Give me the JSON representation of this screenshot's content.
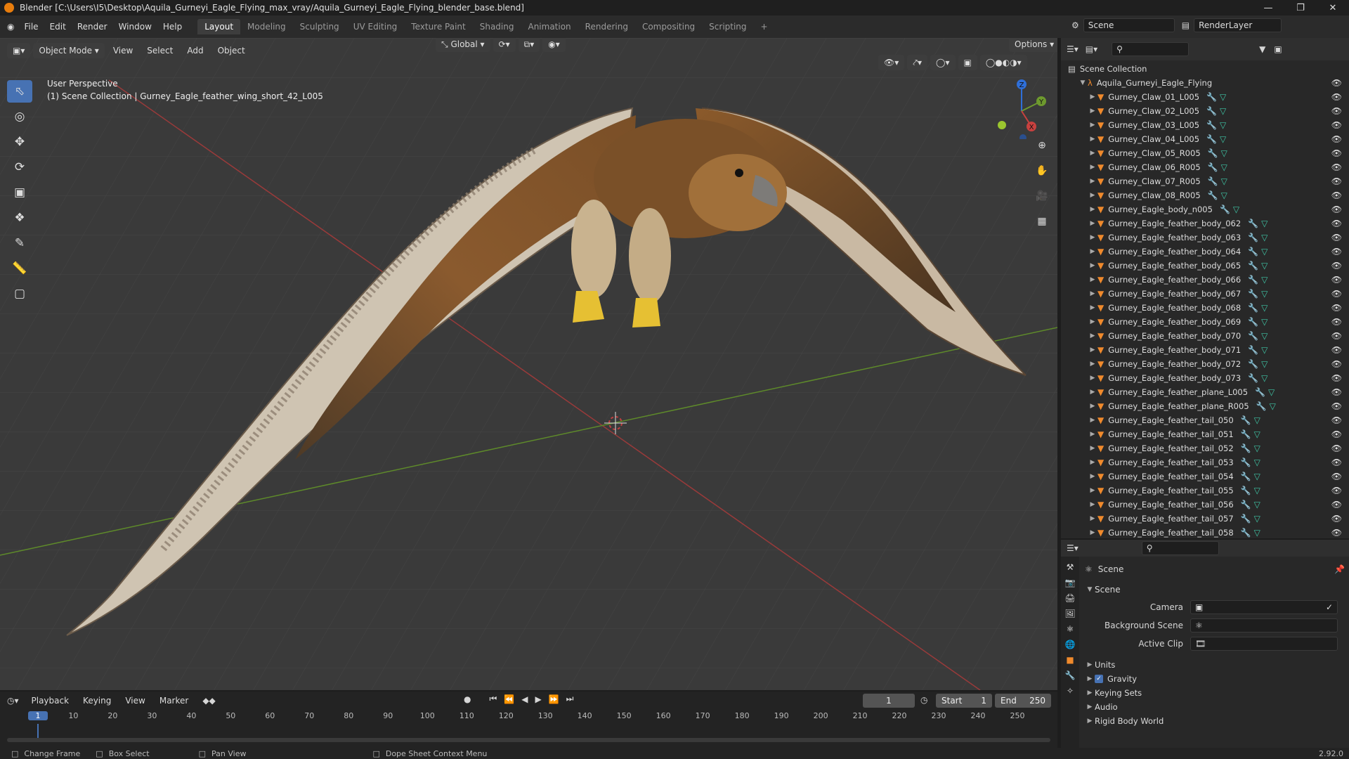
{
  "titlebar": {
    "title": "Blender [C:\\Users\\I5\\Desktop\\Aquila_Gurneyi_Eagle_Flying_max_vray/Aquila_Gurneyi_Eagle_Flying_blender_base.blend]"
  },
  "menus": [
    "File",
    "Edit",
    "Render",
    "Window",
    "Help"
  ],
  "workspaces": [
    "Layout",
    "Modeling",
    "Sculpting",
    "UV Editing",
    "Texture Paint",
    "Shading",
    "Animation",
    "Rendering",
    "Compositing",
    "Scripting"
  ],
  "top_right": {
    "scene": "Scene",
    "render_layer": "RenderLayer"
  },
  "viewport": {
    "mode": "Object Mode",
    "menu": [
      "View",
      "Select",
      "Add",
      "Object"
    ],
    "orientation": "Global",
    "options": "Options",
    "overlay_title": "User Perspective",
    "overlay_sub": "(1) Scene Collection | Gurney_Eagle_feather_wing_short_42_L005",
    "gizmo_axes": [
      "Z",
      "Y",
      "X"
    ]
  },
  "outliner": {
    "root": "Scene Collection",
    "collection": "Aquila_Gurneyi_Eagle_Flying",
    "items": [
      "Gurney_Claw_01_L005",
      "Gurney_Claw_02_L005",
      "Gurney_Claw_03_L005",
      "Gurney_Claw_04_L005",
      "Gurney_Claw_05_R005",
      "Gurney_Claw_06_R005",
      "Gurney_Claw_07_R005",
      "Gurney_Claw_08_R005",
      "Gurney_Eagle_body_n005",
      "Gurney_Eagle_feather_body_062",
      "Gurney_Eagle_feather_body_063",
      "Gurney_Eagle_feather_body_064",
      "Gurney_Eagle_feather_body_065",
      "Gurney_Eagle_feather_body_066",
      "Gurney_Eagle_feather_body_067",
      "Gurney_Eagle_feather_body_068",
      "Gurney_Eagle_feather_body_069",
      "Gurney_Eagle_feather_body_070",
      "Gurney_Eagle_feather_body_071",
      "Gurney_Eagle_feather_body_072",
      "Gurney_Eagle_feather_body_073",
      "Gurney_Eagle_feather_plane_L005",
      "Gurney_Eagle_feather_plane_R005",
      "Gurney_Eagle_feather_tail_050",
      "Gurney_Eagle_feather_tail_051",
      "Gurney_Eagle_feather_tail_052",
      "Gurney_Eagle_feather_tail_053",
      "Gurney_Eagle_feather_tail_054",
      "Gurney_Eagle_feather_tail_055",
      "Gurney_Eagle_feather_tail_056",
      "Gurney_Eagle_feather_tail_057",
      "Gurney_Eagle_feather_tail_058"
    ]
  },
  "properties": {
    "context": "Scene",
    "panel": "Scene",
    "camera_label": "Camera",
    "bg_label": "Background Scene",
    "clip_label": "Active Clip",
    "sections": [
      "Units",
      "Gravity",
      "Keying Sets",
      "Audio",
      "Rigid Body World"
    ],
    "gravity_checked": true
  },
  "timeline": {
    "menus": [
      "Playback",
      "Keying",
      "View",
      "Marker"
    ],
    "current": "1",
    "start_label": "Start",
    "start": "1",
    "end_label": "End",
    "end": "250",
    "ticks": [
      "1",
      "10",
      "20",
      "30",
      "40",
      "50",
      "60",
      "70",
      "80",
      "90",
      "100",
      "110",
      "120",
      "130",
      "140",
      "150",
      "160",
      "170",
      "180",
      "190",
      "200",
      "210",
      "220",
      "230",
      "240",
      "250"
    ]
  },
  "status": {
    "items": [
      "Change Frame",
      "Box Select",
      "Pan View",
      "Dope Sheet Context Menu"
    ],
    "version": "2.92.0"
  },
  "colors": {
    "accent": "#4772b3",
    "object": "#f08a2c",
    "x_axis": "#c8413f",
    "y_axis": "#6e9a2e",
    "z_axis": "#2f6fd8"
  }
}
